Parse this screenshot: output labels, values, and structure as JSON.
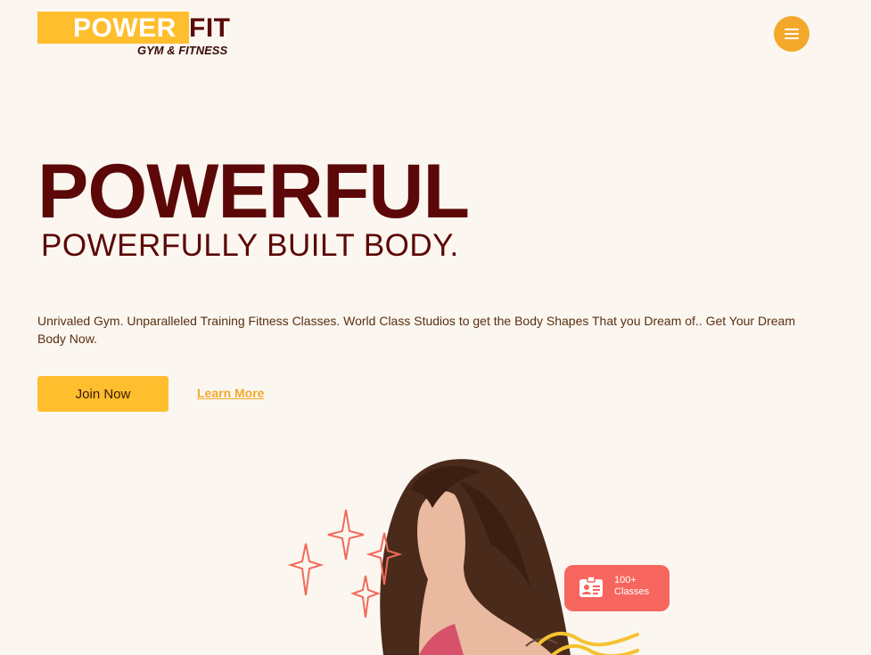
{
  "header": {
    "logo": {
      "word1": "POWER",
      "word2": "FIT",
      "tagline": "GYM & FITNESS"
    },
    "menu_icon": "hamburger-menu-icon"
  },
  "hero": {
    "title": "POWERFUL",
    "subtitle": "POWERFULLY BUILT BODY.",
    "description": "Unrivaled Gym. Unparalleled Training Fitness Classes. World Class Studios to get the Body Shapes That you Dream of.. Get Your Dream Body Now.",
    "join_label": "Join Now",
    "learn_label": "Learn More"
  },
  "badge": {
    "count": "100+",
    "label": "Classes",
    "icon": "id-card-icon"
  },
  "colors": {
    "accent": "#ffbe2e",
    "menu": "#f4a82b",
    "brand_dark": "#5c0808",
    "badge": "#f7665e",
    "background": "#fbf7f0"
  }
}
